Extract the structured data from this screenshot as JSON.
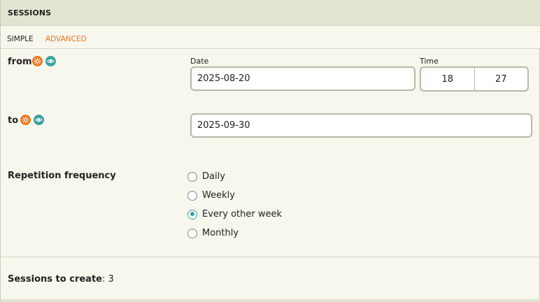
{
  "header": {
    "title": "SESSIONS"
  },
  "tabs": [
    {
      "label": "SIMPLE",
      "active": false
    },
    {
      "label": "ADVANCED",
      "active": true
    }
  ],
  "from": {
    "label": "from",
    "date_label": "Date",
    "date_value": "2025-08-20",
    "time_label": "Time",
    "hour": "18",
    "minute": "27"
  },
  "to": {
    "label": "to",
    "date_value": "2025-09-30"
  },
  "icons": {
    "variable": "sun-icon",
    "visibility": "eye-icon",
    "accent_orange": "#e8781f",
    "accent_teal": "#3aa3a0"
  },
  "repetition": {
    "label": "Repetition frequency",
    "options": [
      "Daily",
      "Weekly",
      "Every other week",
      "Monthly"
    ],
    "selected": "Every other week"
  },
  "summary": {
    "label": "Sessions to create",
    "value": "3"
  }
}
